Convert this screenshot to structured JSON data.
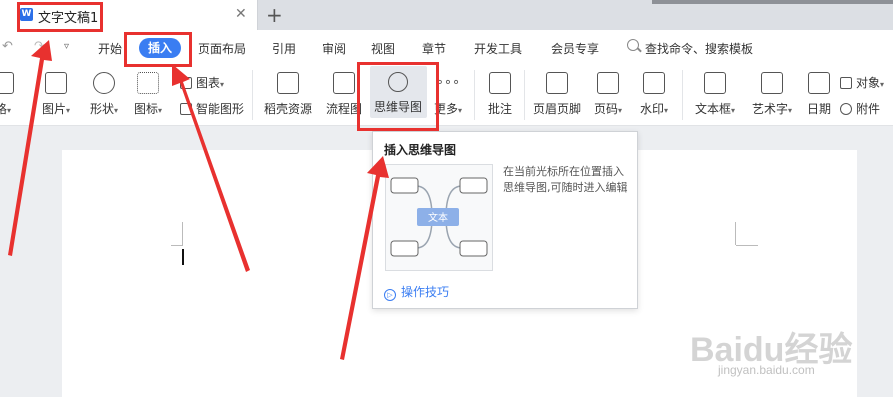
{
  "window": {
    "doc_tab_title": "文字文稿1",
    "close_glyph": "✕",
    "new_tab_glyph": "+",
    "doc_icon_letter": "W"
  },
  "menu": {
    "undo_glyph": "↶",
    "redo_glyph": "↷",
    "more_glyph": "▿",
    "tabs": [
      "开始",
      "插入",
      "页面布局",
      "引用",
      "审阅",
      "视图",
      "章节",
      "开发工具",
      "会员专享"
    ],
    "active_tab": "插入",
    "search_placeholder": "查找命令、搜索模板"
  },
  "ribbon": {
    "table": "格",
    "picture": "图片",
    "shape": "形状",
    "icon": "图标",
    "chart": "图表",
    "smart_graphic": "智能图形",
    "shell_resource": "稻壳资源",
    "flowchart": "流程图",
    "mindmap": "思维导图",
    "more": "更多",
    "comment": "批注",
    "header_footer": "页眉页脚",
    "page_number": "页码",
    "watermark": "水印",
    "textbox": "文本框",
    "art_text": "艺术字",
    "date": "日期",
    "object": "对象",
    "attachment": "附件",
    "more_dots": "∘∘∘",
    "caret": "▾"
  },
  "tooltip": {
    "title": "插入思维导图",
    "description": "在当前光标所在位置插入思维导图,可随时进入编辑",
    "preview_center_label": "文本",
    "tips_link": "操作技巧",
    "tips_glyph": "▷"
  },
  "watermark": {
    "brand": "Baidu经验",
    "url": "jingyan.baidu.com"
  },
  "colors": {
    "accent": "#3a7df2",
    "highlight_red": "#e8312f"
  }
}
